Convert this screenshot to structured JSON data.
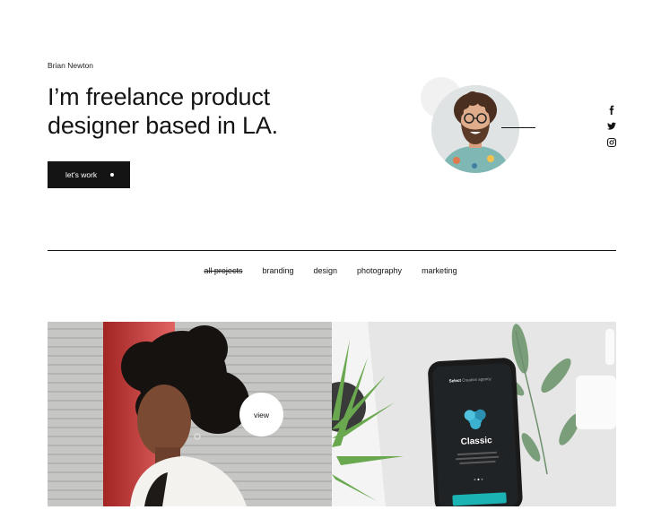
{
  "hero": {
    "author_name": "Brian Newton",
    "title_line1": "I’m freelance product",
    "title_line2": "designer based in LA.",
    "cta_label": "let's work"
  },
  "social": {
    "icons": [
      "facebook-icon",
      "twitter-icon",
      "instagram-icon"
    ]
  },
  "filters": [
    {
      "label": "all projects",
      "active": true
    },
    {
      "label": "branding",
      "active": false
    },
    {
      "label": "design",
      "active": false
    },
    {
      "label": "photography",
      "active": false
    },
    {
      "label": "marketing",
      "active": false
    }
  ],
  "projects": {
    "view_label": "view",
    "phone": {
      "brand": "Select",
      "brand_suffix": "Creative agency",
      "title": "Classic"
    }
  },
  "colors": {
    "text": "#141414",
    "accent_red": "#d8302e",
    "phone_teal": "#1bb3b3"
  }
}
